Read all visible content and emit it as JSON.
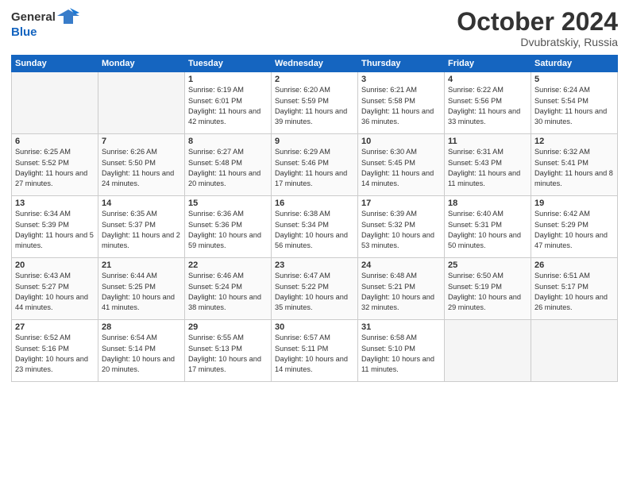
{
  "header": {
    "logo_general": "General",
    "logo_blue": "Blue",
    "month": "October 2024",
    "location": "Dvubratskiy, Russia"
  },
  "weekdays": [
    "Sunday",
    "Monday",
    "Tuesday",
    "Wednesday",
    "Thursday",
    "Friday",
    "Saturday"
  ],
  "weeks": [
    [
      {
        "day": "",
        "info": ""
      },
      {
        "day": "",
        "info": ""
      },
      {
        "day": "1",
        "info": "Sunrise: 6:19 AM\nSunset: 6:01 PM\nDaylight: 11 hours and 42 minutes."
      },
      {
        "day": "2",
        "info": "Sunrise: 6:20 AM\nSunset: 5:59 PM\nDaylight: 11 hours and 39 minutes."
      },
      {
        "day": "3",
        "info": "Sunrise: 6:21 AM\nSunset: 5:58 PM\nDaylight: 11 hours and 36 minutes."
      },
      {
        "day": "4",
        "info": "Sunrise: 6:22 AM\nSunset: 5:56 PM\nDaylight: 11 hours and 33 minutes."
      },
      {
        "day": "5",
        "info": "Sunrise: 6:24 AM\nSunset: 5:54 PM\nDaylight: 11 hours and 30 minutes."
      }
    ],
    [
      {
        "day": "6",
        "info": "Sunrise: 6:25 AM\nSunset: 5:52 PM\nDaylight: 11 hours and 27 minutes."
      },
      {
        "day": "7",
        "info": "Sunrise: 6:26 AM\nSunset: 5:50 PM\nDaylight: 11 hours and 24 minutes."
      },
      {
        "day": "8",
        "info": "Sunrise: 6:27 AM\nSunset: 5:48 PM\nDaylight: 11 hours and 20 minutes."
      },
      {
        "day": "9",
        "info": "Sunrise: 6:29 AM\nSunset: 5:46 PM\nDaylight: 11 hours and 17 minutes."
      },
      {
        "day": "10",
        "info": "Sunrise: 6:30 AM\nSunset: 5:45 PM\nDaylight: 11 hours and 14 minutes."
      },
      {
        "day": "11",
        "info": "Sunrise: 6:31 AM\nSunset: 5:43 PM\nDaylight: 11 hours and 11 minutes."
      },
      {
        "day": "12",
        "info": "Sunrise: 6:32 AM\nSunset: 5:41 PM\nDaylight: 11 hours and 8 minutes."
      }
    ],
    [
      {
        "day": "13",
        "info": "Sunrise: 6:34 AM\nSunset: 5:39 PM\nDaylight: 11 hours and 5 minutes."
      },
      {
        "day": "14",
        "info": "Sunrise: 6:35 AM\nSunset: 5:37 PM\nDaylight: 11 hours and 2 minutes."
      },
      {
        "day": "15",
        "info": "Sunrise: 6:36 AM\nSunset: 5:36 PM\nDaylight: 10 hours and 59 minutes."
      },
      {
        "day": "16",
        "info": "Sunrise: 6:38 AM\nSunset: 5:34 PM\nDaylight: 10 hours and 56 minutes."
      },
      {
        "day": "17",
        "info": "Sunrise: 6:39 AM\nSunset: 5:32 PM\nDaylight: 10 hours and 53 minutes."
      },
      {
        "day": "18",
        "info": "Sunrise: 6:40 AM\nSunset: 5:31 PM\nDaylight: 10 hours and 50 minutes."
      },
      {
        "day": "19",
        "info": "Sunrise: 6:42 AM\nSunset: 5:29 PM\nDaylight: 10 hours and 47 minutes."
      }
    ],
    [
      {
        "day": "20",
        "info": "Sunrise: 6:43 AM\nSunset: 5:27 PM\nDaylight: 10 hours and 44 minutes."
      },
      {
        "day": "21",
        "info": "Sunrise: 6:44 AM\nSunset: 5:25 PM\nDaylight: 10 hours and 41 minutes."
      },
      {
        "day": "22",
        "info": "Sunrise: 6:46 AM\nSunset: 5:24 PM\nDaylight: 10 hours and 38 minutes."
      },
      {
        "day": "23",
        "info": "Sunrise: 6:47 AM\nSunset: 5:22 PM\nDaylight: 10 hours and 35 minutes."
      },
      {
        "day": "24",
        "info": "Sunrise: 6:48 AM\nSunset: 5:21 PM\nDaylight: 10 hours and 32 minutes."
      },
      {
        "day": "25",
        "info": "Sunrise: 6:50 AM\nSunset: 5:19 PM\nDaylight: 10 hours and 29 minutes."
      },
      {
        "day": "26",
        "info": "Sunrise: 6:51 AM\nSunset: 5:17 PM\nDaylight: 10 hours and 26 minutes."
      }
    ],
    [
      {
        "day": "27",
        "info": "Sunrise: 6:52 AM\nSunset: 5:16 PM\nDaylight: 10 hours and 23 minutes."
      },
      {
        "day": "28",
        "info": "Sunrise: 6:54 AM\nSunset: 5:14 PM\nDaylight: 10 hours and 20 minutes."
      },
      {
        "day": "29",
        "info": "Sunrise: 6:55 AM\nSunset: 5:13 PM\nDaylight: 10 hours and 17 minutes."
      },
      {
        "day": "30",
        "info": "Sunrise: 6:57 AM\nSunset: 5:11 PM\nDaylight: 10 hours and 14 minutes."
      },
      {
        "day": "31",
        "info": "Sunrise: 6:58 AM\nSunset: 5:10 PM\nDaylight: 10 hours and 11 minutes."
      },
      {
        "day": "",
        "info": ""
      },
      {
        "day": "",
        "info": ""
      }
    ]
  ]
}
